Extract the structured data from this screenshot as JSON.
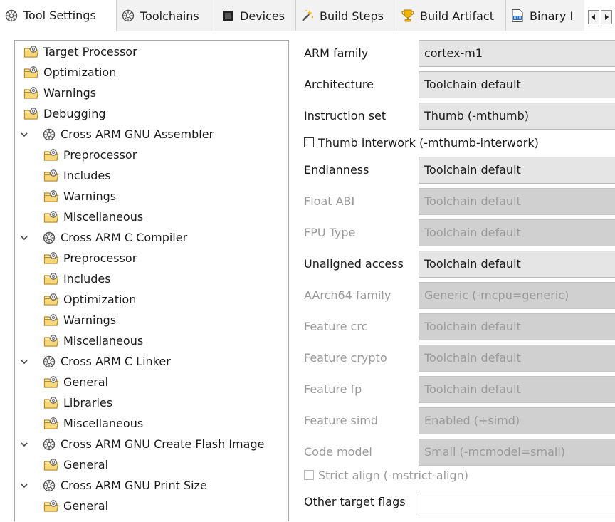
{
  "tabs": [
    {
      "label": "Tool Settings",
      "icon": "gear-icon"
    },
    {
      "label": "Toolchains",
      "icon": "gear-icon"
    },
    {
      "label": "Devices",
      "icon": "chip-icon"
    },
    {
      "label": "Build Steps",
      "icon": "wand-icon"
    },
    {
      "label": "Build Artifact",
      "icon": "trophy-icon"
    },
    {
      "label": "Binary I",
      "icon": "binary-file-icon"
    }
  ],
  "tree": {
    "items": [
      {
        "label": "Target Processor",
        "level": 1,
        "selected": true
      },
      {
        "label": "Optimization",
        "level": 1
      },
      {
        "label": "Warnings",
        "level": 1
      },
      {
        "label": "Debugging",
        "level": 1
      },
      {
        "label": "Cross ARM GNU Assembler",
        "level": 0
      },
      {
        "label": "Preprocessor",
        "level": 1
      },
      {
        "label": "Includes",
        "level": 1
      },
      {
        "label": "Warnings",
        "level": 1
      },
      {
        "label": "Miscellaneous",
        "level": 1
      },
      {
        "label": "Cross ARM C Compiler",
        "level": 0
      },
      {
        "label": "Preprocessor",
        "level": 1
      },
      {
        "label": "Includes",
        "level": 1
      },
      {
        "label": "Optimization",
        "level": 1
      },
      {
        "label": "Warnings",
        "level": 1
      },
      {
        "label": "Miscellaneous",
        "level": 1
      },
      {
        "label": "Cross ARM C Linker",
        "level": 0
      },
      {
        "label": "General",
        "level": 1
      },
      {
        "label": "Libraries",
        "level": 1
      },
      {
        "label": "Miscellaneous",
        "level": 1
      },
      {
        "label": "Cross ARM GNU Create Flash Image",
        "level": 0
      },
      {
        "label": "General",
        "level": 1
      },
      {
        "label": "Cross ARM GNU Print Size",
        "level": 0
      },
      {
        "label": "General",
        "level": 1
      }
    ]
  },
  "settings": {
    "arm_family": {
      "label": "ARM family",
      "value": "cortex-m1"
    },
    "architecture": {
      "label": "Architecture",
      "value": "Toolchain default"
    },
    "instruction_set": {
      "label": "Instruction set",
      "value": "Thumb (-mthumb)"
    },
    "thumb_interwork": {
      "label": "Thumb interwork (-mthumb-interwork)",
      "checked": false
    },
    "endianness": {
      "label": "Endianness",
      "value": "Toolchain default"
    },
    "float_abi": {
      "label": "Float ABI",
      "value": "Toolchain default"
    },
    "fpu_type": {
      "label": "FPU Type",
      "value": "Toolchain default"
    },
    "unaligned_access": {
      "label": "Unaligned access",
      "value": "Toolchain default"
    },
    "aarch64_family": {
      "label": "AArch64 family",
      "value": "Generic (-mcpu=generic)"
    },
    "feature_crc": {
      "label": "Feature crc",
      "value": "Toolchain default"
    },
    "feature_crypto": {
      "label": "Feature crypto",
      "value": "Toolchain default"
    },
    "feature_fp": {
      "label": "Feature fp",
      "value": "Toolchain default"
    },
    "feature_simd": {
      "label": "Feature simd",
      "value": "Enabled (+simd)"
    },
    "code_model": {
      "label": "Code model",
      "value": "Small (-mcmodel=small)"
    },
    "strict_align": {
      "label": "Strict align (-mstrict-align)",
      "checked": false
    },
    "other_target_flags": {
      "label": "Other target flags",
      "value": ""
    }
  },
  "colors": {
    "selection": "#cce4f7",
    "disabled_text": "#9a9a9a",
    "field_bg": "#e5e5e5",
    "field_disabled_bg": "#d0d0d0"
  }
}
